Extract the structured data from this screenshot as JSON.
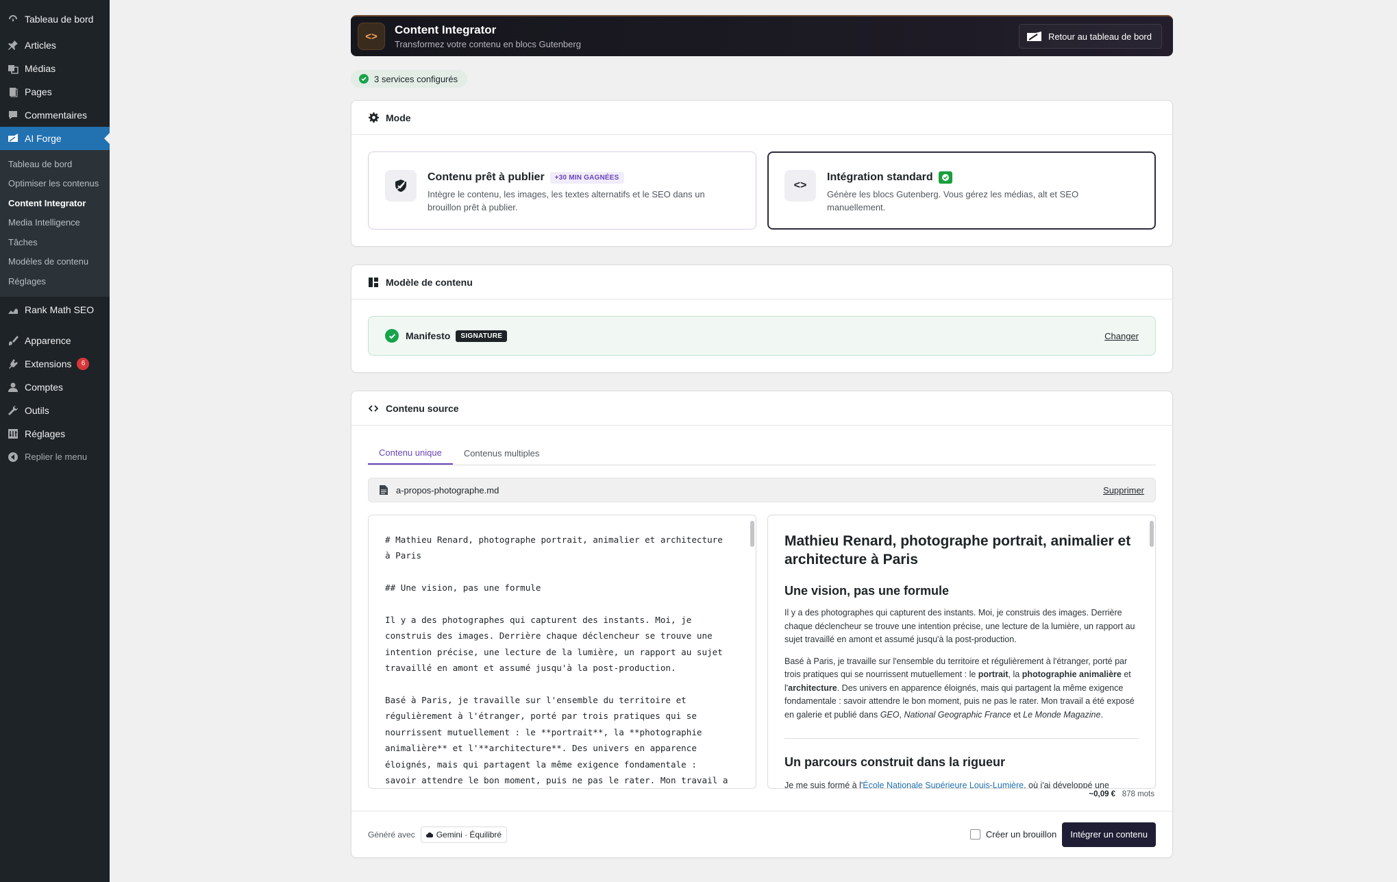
{
  "sidebar": {
    "items": [
      {
        "label": "Tableau de bord",
        "icon": "dashboard-icon"
      },
      {
        "label": "Articles",
        "icon": "pin-icon"
      },
      {
        "label": "Médias",
        "icon": "media-icon"
      },
      {
        "label": "Pages",
        "icon": "page-icon"
      },
      {
        "label": "Commentaires",
        "icon": "comment-icon"
      },
      {
        "label": "AI Forge",
        "icon": "forge-icon"
      }
    ],
    "submenu": [
      "Tableau de bord",
      "Optimiser les contenus",
      "Content Integrator",
      "Media Intelligence",
      "Tâches",
      "Modèles de contenu",
      "Réglages"
    ],
    "items2": [
      {
        "label": "Rank Math SEO",
        "icon": "chart-icon"
      },
      {
        "label": "Apparence",
        "icon": "brush-icon"
      },
      {
        "label": "Extensions",
        "icon": "plugin-icon",
        "badge": "6"
      },
      {
        "label": "Comptes",
        "icon": "user-icon"
      },
      {
        "label": "Outils",
        "icon": "wrench-icon"
      },
      {
        "label": "Réglages",
        "icon": "settings-icon"
      }
    ],
    "collapse_label": "Replier le menu",
    "colors": {
      "bg": "#1d2327",
      "active": "#2271b1",
      "badge": "#d63638"
    }
  },
  "header": {
    "icon_glyph": "<>",
    "title": "Content Integrator",
    "subtitle": "Transformez votre contenu en blocs Gutenberg",
    "back_button": "Retour au tableau de bord"
  },
  "status_pill": "3 services configurés",
  "mode": {
    "title": "Mode",
    "options": [
      {
        "title": "Contenu prêt à publier",
        "tag": "+30 MIN GAGNÉES",
        "desc": "Intègre le contenu, les images, les textes alternatifs et le SEO dans un brouillon prêt à publier.",
        "selected": false
      },
      {
        "title": "Intégration standard",
        "icon_glyph": "<>",
        "desc": "Génère les blocs Gutenberg. Vous gérez les médias, alt et SEO manuellement.",
        "selected": true
      }
    ]
  },
  "template": {
    "title": "Modèle de contenu",
    "name": "Manifesto",
    "tag": "SIGNATURE",
    "change": "Changer"
  },
  "source": {
    "title": "Contenu source",
    "tabs": [
      "Contenu unique",
      "Contenus multiples"
    ],
    "active_tab": 0,
    "file_name": "a-propos-photographe.md",
    "remove": "Supprimer",
    "markdown": "# Mathieu Renard, photographe portrait, animalier et architecture\nà Paris\n\n## Une vision, pas une formule\n\nIl y a des photographes qui capturent des instants. Moi, je\nconstruis des images. Derrière chaque déclencheur se trouve une\nintention précise, une lecture de la lumière, un rapport au sujet\ntravaillé en amont et assumé jusqu'à la post-production.\n\nBasé à Paris, je travaille sur l'ensemble du territoire et\nrégulièrement à l'étranger, porté par trois pratiques qui se\nnourrissent mutuellement : le **portrait**, la **photographie\nanimalière** et l'**architecture**. Des univers en apparence\néloignés, mais qui partagent la même exigence fondamentale :\nsavoir attendre le bon moment, puis ne pas le rater. Mon travail a",
    "preview": {
      "h1": "Mathieu Renard, photographe portrait, animalier et architecture à Paris",
      "h2a": "Une vision, pas une formule",
      "p1": "Il y a des photographes qui capturent des instants. Moi, je construis des images. Derrière chaque déclencheur se trouve une intention précise, une lecture de la lumière, un rapport au sujet travaillé en amont et assumé jusqu'à la post-production.",
      "p2_a": "Basé à Paris, je travaille sur l'ensemble du territoire et régulièrement à l'étranger, porté par trois pratiques qui se nourrissent mutuellement : le ",
      "p2_b1": "portrait",
      "p2_c": ", la ",
      "p2_b2": "photographie animalière",
      "p2_d": " et l'",
      "p2_b3": "architecture",
      "p2_e": ". Des univers en apparence éloignés, mais qui partagent la même exigence fondamentale : savoir attendre le bon moment, puis ne pas le rater. Mon travail a été exposé en galerie et publié dans ",
      "p2_i1": "GEO",
      "p2_f": ", ",
      "p2_i2": "National Geographic France",
      "p2_g": " et ",
      "p2_i3": "Le Monde Magazine",
      "p2_h": ".",
      "h2b": "Un parcours construit dans la rigueur",
      "p3_a": "Je me suis formé à l'",
      "p3_link": "École Nationale Supérieure Louis-Lumière",
      "p3_b": ", où j'ai développé une"
    },
    "cost": "~0,09 €",
    "words": "878 mots"
  },
  "footer": {
    "generated_with": "Généré avec",
    "model": "Gemini · Équilibré",
    "draft_label": "Créer un brouillon",
    "submit": "Intégrer un contenu"
  }
}
